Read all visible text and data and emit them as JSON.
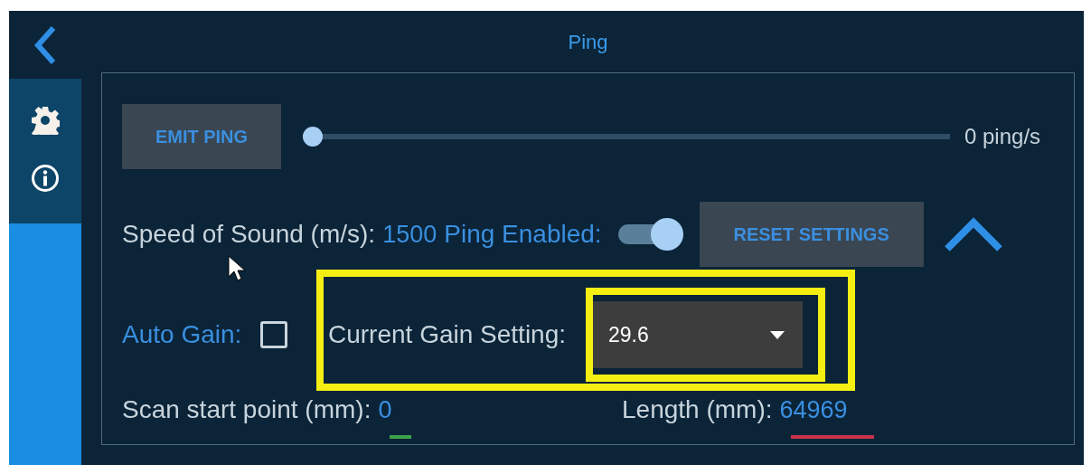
{
  "header": {
    "title": "Ping"
  },
  "sidebar": {
    "items": [
      {
        "kind": "settings"
      },
      {
        "kind": "info"
      }
    ]
  },
  "ping": {
    "emit_button": "EMIT PING",
    "rate_slider": {
      "level": 0
    },
    "rate_reading": "0 ping/s"
  },
  "settings": {
    "speed_label": "Speed of Sound (m/s):",
    "speed_value": "1500",
    "ping_enabled_label": "Ping Enabled:",
    "ping_enabled": {
      "on": true
    },
    "reset_button": "RESET SETTINGS"
  },
  "gain": {
    "auto_gain_label": "Auto Gain:",
    "auto_gain": {
      "checked": false
    },
    "current_label": "Current Gain Setting:",
    "current_value": "29.6"
  },
  "range": {
    "start_label": "Scan start point (mm):",
    "start_value": "0",
    "length_label": "Length (mm):",
    "length_value": "64969"
  }
}
